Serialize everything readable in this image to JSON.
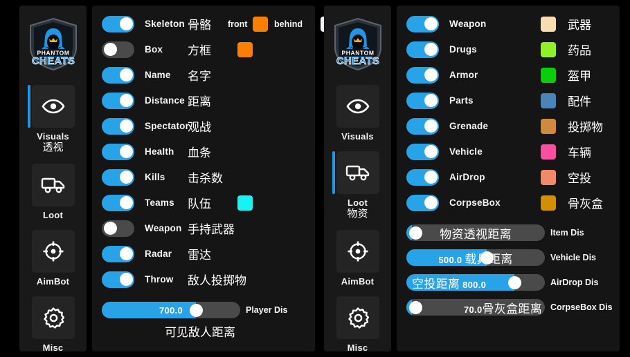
{
  "app": {
    "brand_top": "PHANTOM",
    "brand_bottom": "CHEATS",
    "accent": "#29a3e8",
    "panel_bg": "#151515",
    "sidebar_bg": "#191919"
  },
  "sidebar": {
    "items": [
      {
        "id": "visuals",
        "label_en": "Visuals",
        "label_cn": "透视",
        "icon": "eye-icon"
      },
      {
        "id": "loot",
        "label_en": "Loot",
        "label_cn": "",
        "icon": "truck-icon"
      },
      {
        "id": "aimbot",
        "label_en": "AimBot",
        "label_cn": "",
        "icon": "crosshair-icon"
      },
      {
        "id": "misc",
        "label_en": "Misc",
        "label_cn": "",
        "icon": "gear-icon"
      }
    ],
    "active": "visuals"
  },
  "sidebar2": {
    "items": [
      {
        "id": "visuals",
        "label_en": "Visuals",
        "label_cn": "",
        "icon": "eye-icon"
      },
      {
        "id": "loot",
        "label_en": "Loot",
        "label_cn": "物资",
        "icon": "truck-icon"
      },
      {
        "id": "aimbot",
        "label_en": "AimBot",
        "label_cn": "",
        "icon": "crosshair-icon"
      },
      {
        "id": "misc",
        "label_en": "Misc",
        "label_cn": "",
        "icon": "gear-icon"
      }
    ],
    "active": "loot"
  },
  "visuals": {
    "rows": [
      {
        "en": "Skeleton",
        "cn": "骨骼",
        "on": true,
        "front_label": "front",
        "front_color": "#fa8005",
        "behind_label": "behind",
        "behind_color": "#f5f5fb"
      },
      {
        "en": "Box",
        "cn": "方框",
        "on": false,
        "box_color": "#fa8005"
      },
      {
        "en": "Name",
        "cn": "名字",
        "on": true
      },
      {
        "en": "Distance",
        "cn": "距离",
        "on": true
      },
      {
        "en": "Spectator",
        "cn": "观战",
        "on": true
      },
      {
        "en": "Health",
        "cn": "血条",
        "on": true
      },
      {
        "en": "Kills",
        "cn": "击杀数",
        "on": true
      },
      {
        "en": "Teams",
        "cn": "队伍",
        "on": true,
        "team_color": "#19f2f2"
      },
      {
        "en": "Weapon",
        "cn": "手持武器",
        "on": false
      },
      {
        "en": "Radar",
        "cn": "雷达",
        "on": true
      },
      {
        "en": "Throw",
        "cn": "敌人投掷物",
        "on": true
      }
    ],
    "slider": {
      "value": "700.0",
      "caption_en": "Player Dis",
      "caption_cn": "可见敌人距离",
      "fill_percent": 68
    }
  },
  "loot": {
    "rows": [
      {
        "en": "Weapon",
        "cn": "武器",
        "on": true,
        "color": "#f9ddb2"
      },
      {
        "en": "Drugs",
        "cn": "药品",
        "on": true,
        "color": "#8ff029"
      },
      {
        "en": "Armor",
        "cn": "盔甲",
        "on": true,
        "color": "#0ace09"
      },
      {
        "en": "Parts",
        "cn": "配件",
        "on": true,
        "color": "#4a84b8"
      },
      {
        "en": "Grenade",
        "cn": "投掷物",
        "on": true,
        "color": "#d08a3f"
      },
      {
        "en": "Vehicle",
        "cn": "车辆",
        "on": true,
        "color": "#fa4fa0"
      },
      {
        "en": "AirDrop",
        "cn": "空投",
        "on": true,
        "color": "#f08b6a"
      },
      {
        "en": "CorpseBox",
        "cn": "骨灰盒",
        "on": true,
        "color": "#d08f06"
      }
    ],
    "sliders": [
      {
        "value": "",
        "cn": "物资透视距离",
        "caption_en": "Item Dis",
        "fill_percent": 4,
        "order": "cn_only"
      },
      {
        "value": "500.0",
        "cn": "载具距离",
        "caption_en": "Vehicle Dis",
        "fill_percent": 58,
        "order": "value_cn"
      },
      {
        "value": "800.0",
        "cn": "空投距离",
        "caption_en": "AirDrop Dis",
        "fill_percent": 78,
        "order": "cn_value"
      },
      {
        "value": "70.0",
        "cn": "骨灰盒距离",
        "caption_en": "CorpseBox Dis",
        "fill_percent": 4,
        "order": "value_cn"
      }
    ]
  }
}
